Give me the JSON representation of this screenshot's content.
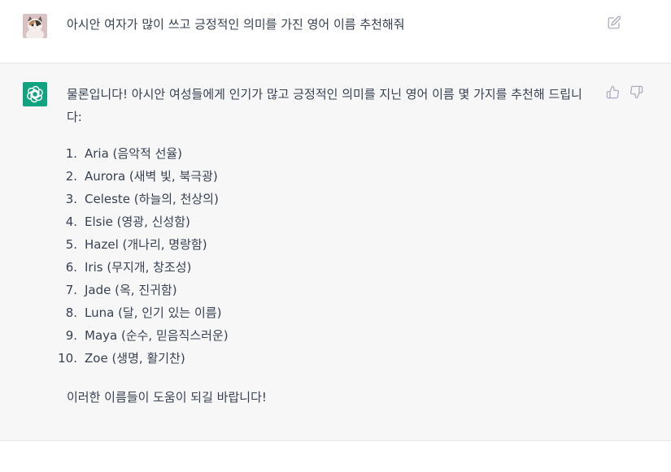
{
  "user_message": {
    "text": "아시안 여자가 많이 쓰고 긍정적인 의미를 가진 영어 이름 추천해줘",
    "edit_icon": "pencil-square-icon"
  },
  "assistant_message": {
    "intro": "물론입니다! 아시안 여성들에게 인기가 많고 긍정적인 의미를 지닌 영어 이름 몇 가지를 추천해 드립니다:",
    "items": [
      {
        "num": "1.",
        "text": "Aria (음악적 선율)"
      },
      {
        "num": "2.",
        "text": "Aurora (새벽 빛, 북극광)"
      },
      {
        "num": "3.",
        "text": "Celeste (하늘의, 천상의)"
      },
      {
        "num": "4.",
        "text": "Elsie (영광, 신성함)"
      },
      {
        "num": "5.",
        "text": "Hazel (개나리, 명랑함)"
      },
      {
        "num": "6.",
        "text": "Iris (무지개, 창조성)"
      },
      {
        "num": "7.",
        "text": "Jade (옥, 진귀함)"
      },
      {
        "num": "8.",
        "text": "Luna (달, 인기 있는 이름)"
      },
      {
        "num": "9.",
        "text": "Maya (순수, 믿음직스러운)"
      },
      {
        "num": "10.",
        "text": "Zoe (생명, 활기찬)"
      }
    ],
    "outro": "이러한 이름들이 도움이 되길 바랍니다!",
    "feedback_icons": [
      "thumbs-up-icon",
      "thumbs-down-icon"
    ]
  },
  "colors": {
    "assistant_bg": "#f7f7f8",
    "avatar_green": "#10a37f",
    "text": "#374151",
    "icon_gray": "#acacbe"
  }
}
